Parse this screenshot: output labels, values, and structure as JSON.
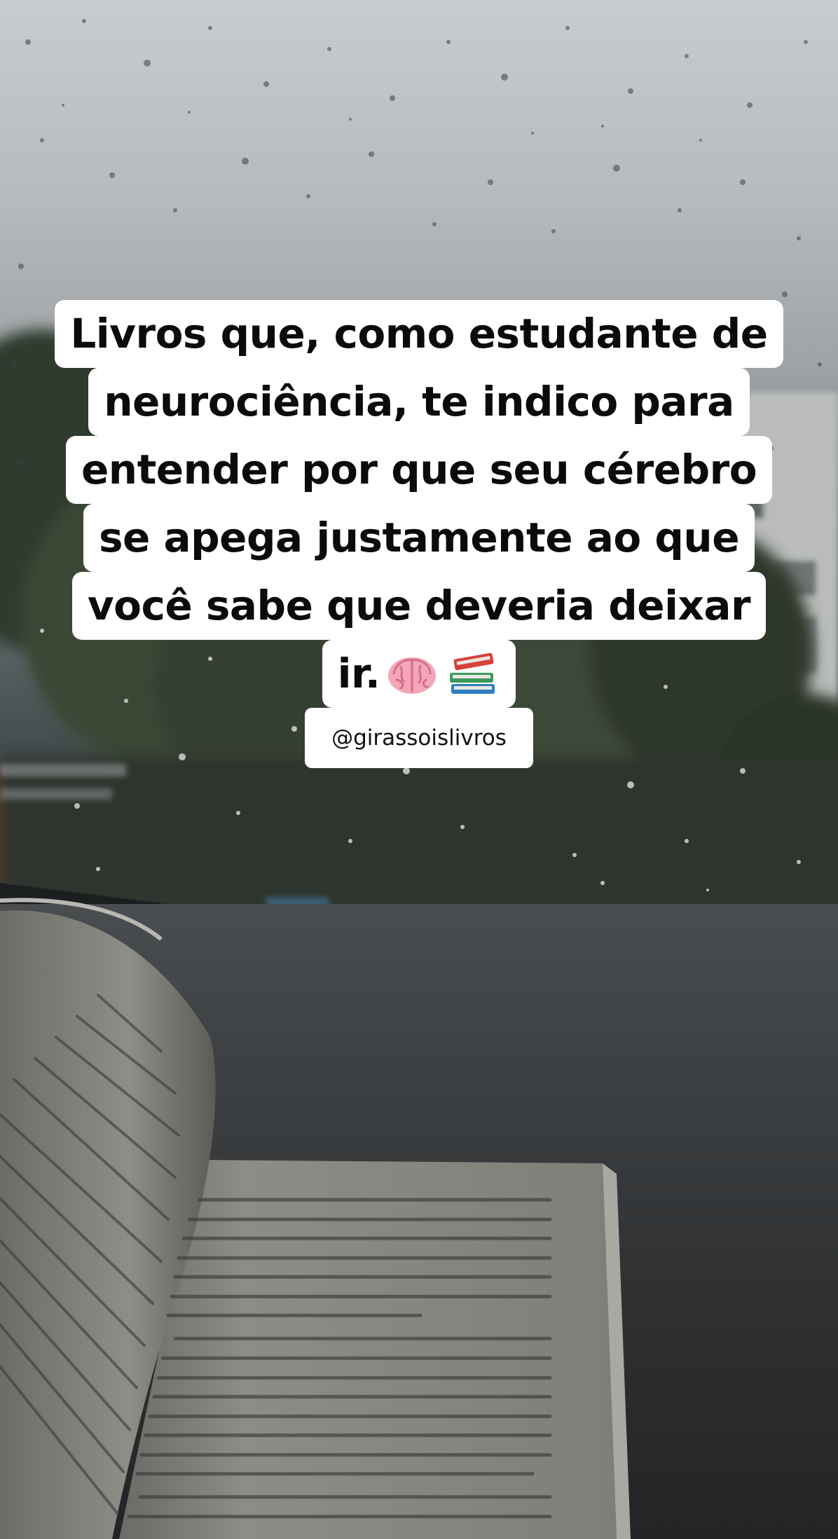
{
  "caption": {
    "lines": [
      "Livros que, como estudante de",
      "neurociência, te indico para",
      "entender por que seu cérebro",
      "se apega justamente ao que",
      "você sabe que deveria deixar",
      "ir."
    ],
    "emojis": [
      "brain-emoji",
      "books-emoji"
    ]
  },
  "handle": "@girassoislivros",
  "scene": {
    "description_colors": {
      "overlay_bg": "#ffffff",
      "overlay_text": "#0b0b0b"
    }
  }
}
